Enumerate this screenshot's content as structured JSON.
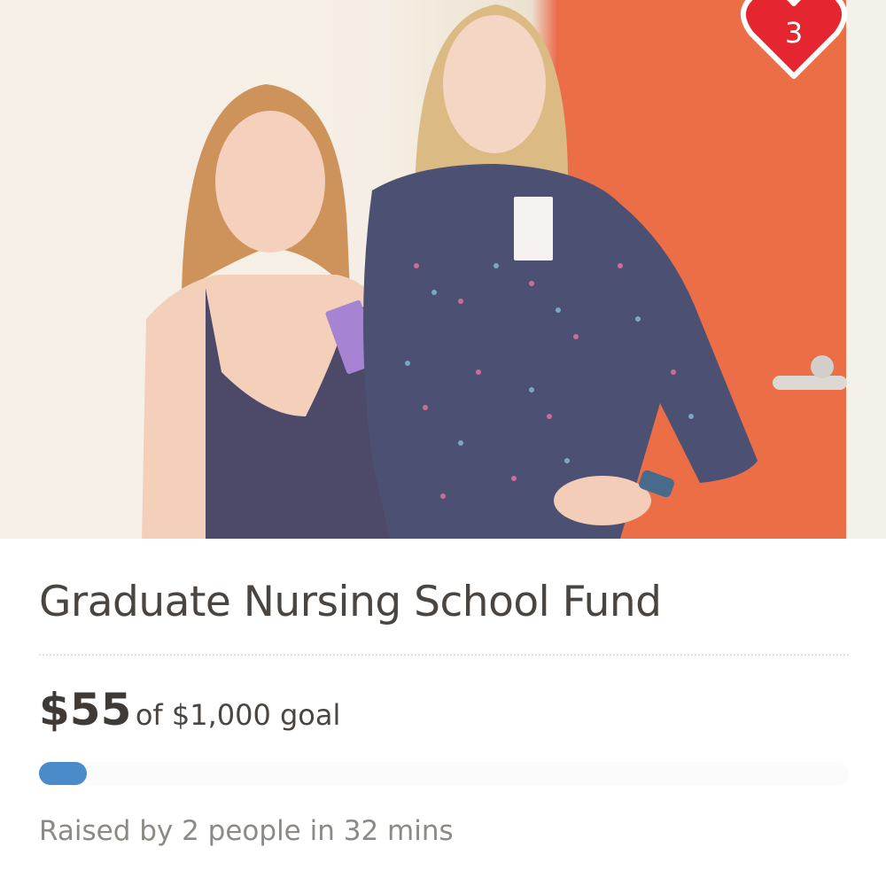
{
  "campaign": {
    "title": "Graduate Nursing School Fund",
    "raised_amount": "$55",
    "goal_text": "of $1,000 goal",
    "progress": 0.055,
    "raised_by": "Raised by 2 people in 32 mins"
  },
  "hearts": {
    "count": "3",
    "icon": "heart-icon",
    "color": "#e52530"
  },
  "colors": {
    "progress_fill": "#4a8bc9",
    "title_text": "#4a4540",
    "muted_text": "#8d8984"
  }
}
